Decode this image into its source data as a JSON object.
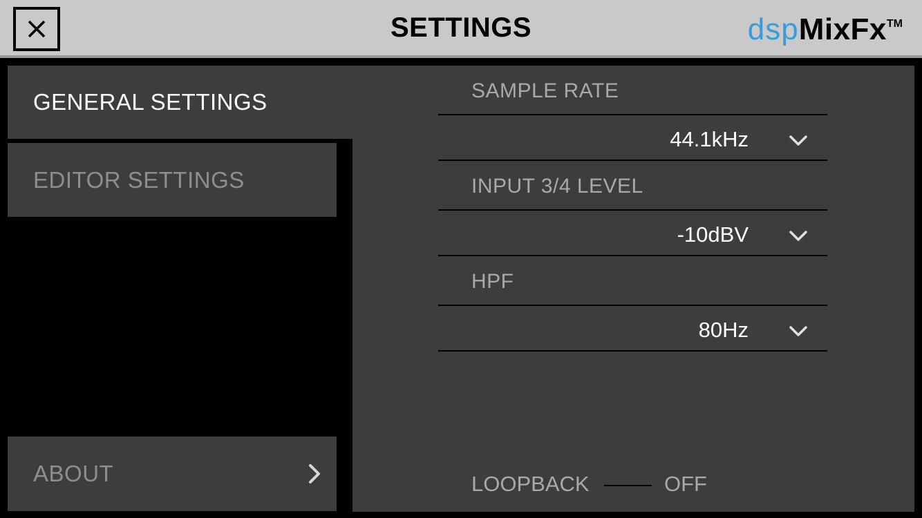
{
  "header": {
    "title": "SETTINGS",
    "close_icon": "close-icon",
    "logo": {
      "part1": "dsp",
      "part2": "MixFx",
      "trademark": "TM"
    }
  },
  "nav": {
    "general": "GENERAL SETTINGS",
    "editor": "EDITOR SETTINGS",
    "about": "ABOUT",
    "about_icon": "chevron-right-icon"
  },
  "settings": {
    "sample_rate": {
      "label": "SAMPLE RATE",
      "value": "44.1kHz"
    },
    "input_level": {
      "label": "INPUT 3/4 LEVEL",
      "value": "-10dBV"
    },
    "hpf": {
      "label": "HPF",
      "value": "80Hz"
    },
    "loopback": {
      "label": "LOOPBACK",
      "value": "OFF"
    },
    "dropdown_icon": "chevron-down-icon"
  },
  "colors": {
    "header_bg": "#c9c9c9",
    "panel_bg": "#3d3d3d",
    "accent_blue": "#3a9bd8",
    "muted_text": "#a9a9a9"
  }
}
